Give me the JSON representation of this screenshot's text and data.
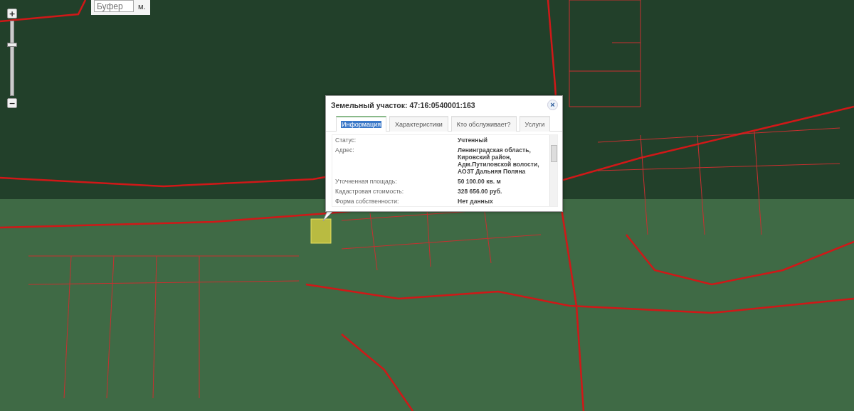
{
  "zoom_control": {
    "zoom_in": "+",
    "zoom_out": "−",
    "level": 0.68
  },
  "buffer": {
    "placeholder": "Буфер",
    "unit": "м."
  },
  "popup": {
    "title": "Земельный участок: 47:16:0540001:163",
    "close": "×",
    "tabs": [
      {
        "label": "Информация",
        "selected": true
      },
      {
        "label": "Характеристики",
        "selected": false
      },
      {
        "label": "Кто обслуживает?",
        "selected": false
      },
      {
        "label": "Услуги",
        "selected": false
      }
    ],
    "rows": [
      {
        "label": "Статус:",
        "value": [
          "Учтенный"
        ]
      },
      {
        "label": "Адрес:",
        "value": [
          "Ленинградская область,",
          "Кировский район,",
          "Адм.Путиловской волости,",
          "АОЗТ Дальняя Поляна"
        ]
      },
      {
        "label": "Уточненная площадь:",
        "value": [
          "50 100.00 кв. м"
        ]
      },
      {
        "label": "Кадастровая стоимость:",
        "value": [
          "328 656.00 руб."
        ]
      },
      {
        "label": "Форма собственности:",
        "value": [
          "Нет данных"
        ]
      }
    ]
  }
}
